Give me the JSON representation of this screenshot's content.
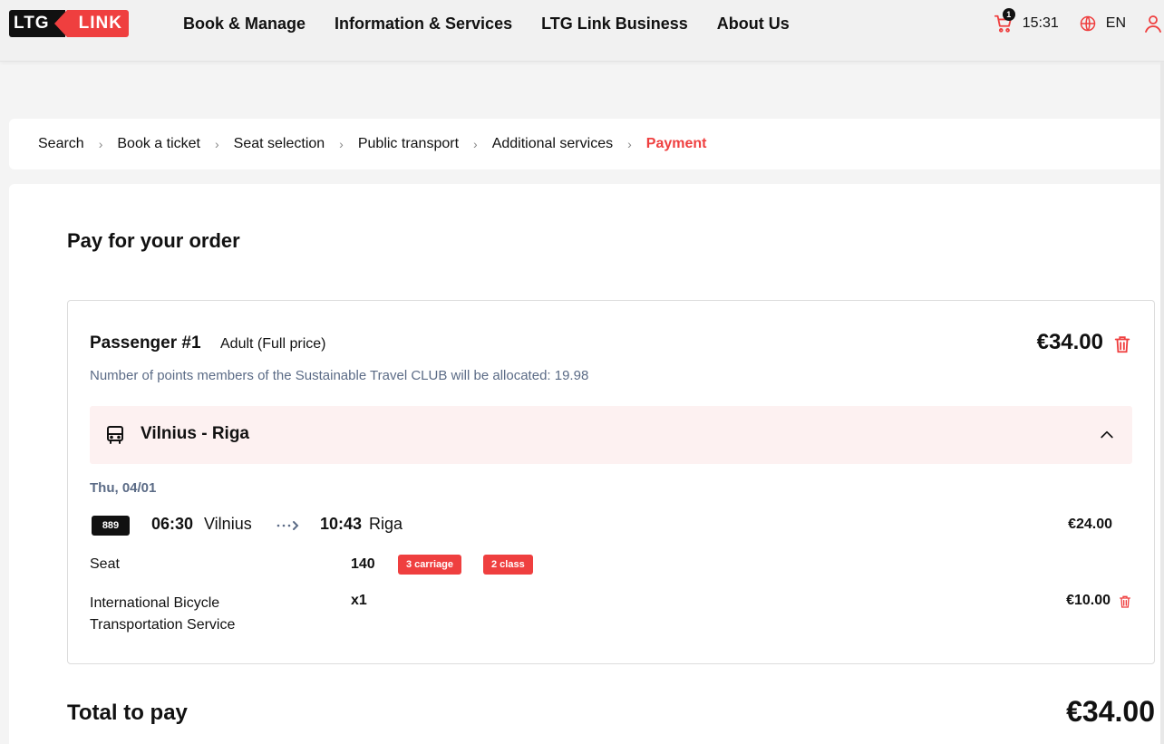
{
  "header": {
    "logo_left": "LTG",
    "logo_right": "LINK",
    "nav": [
      {
        "label": "Book & Manage"
      },
      {
        "label": "Information & Services"
      },
      {
        "label": "LTG Link Business"
      },
      {
        "label": "About Us"
      }
    ],
    "cart_count": "1",
    "time": "15:31",
    "language": "EN"
  },
  "breadcrumb": [
    {
      "label": "Search"
    },
    {
      "label": "Book a ticket"
    },
    {
      "label": "Seat selection"
    },
    {
      "label": "Public transport"
    },
    {
      "label": "Additional services"
    },
    {
      "label": "Payment"
    }
  ],
  "page": {
    "title": "Pay for your order",
    "passenger": {
      "name": "Passenger #1",
      "type": "Adult (Full price)",
      "price": "€34.00",
      "points_note": "Number of points members of the Sustainable Travel CLUB will be allocated: 19.98"
    },
    "route": {
      "title": "Vilnius - Riga",
      "date": "Thu, 04/01",
      "train_number": "889",
      "departure_time": "06:30",
      "departure_city": "Vilnius",
      "arrival_time": "10:43",
      "arrival_city": "Riga",
      "price": "€24.00"
    },
    "seat": {
      "label": "Seat",
      "number": "140",
      "carriage": "3 carriage",
      "class": "2 class"
    },
    "service": {
      "label": "International Bicycle Transportation Service",
      "quantity": "x1",
      "price": "€10.00"
    },
    "total": {
      "label": "Total to pay",
      "value": "€34.00"
    }
  },
  "colors": {
    "accent": "#ef3f3f",
    "muted_text": "#5b6b86",
    "route_bg": "#fdf1f1"
  }
}
